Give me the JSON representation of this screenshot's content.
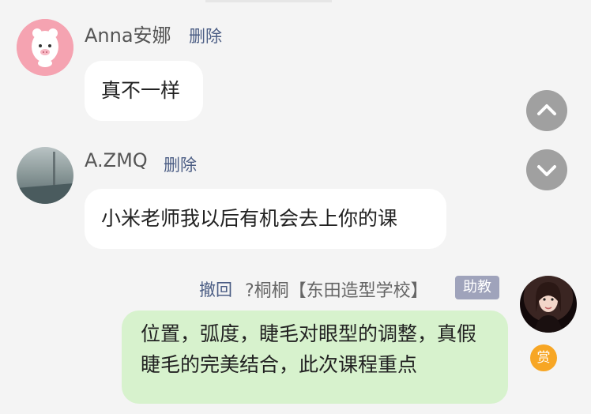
{
  "messages": [
    {
      "name": "Anna安娜",
      "action": "删除",
      "text": "真不一样"
    },
    {
      "name": "A.ZMQ",
      "action": "删除",
      "text": "小米老师我以后有机会去上你的课"
    },
    {
      "action": "撤回",
      "name": "?桐桐【东田造型学校】",
      "badge": "助教",
      "text": "位置，弧度，睫毛对眼型的调整，真假睫毛的完美结合，此次课程重点",
      "reward": "赏"
    }
  ],
  "icons": {
    "scroll_up": "chevron-up-icon",
    "scroll_down": "chevron-down-icon"
  }
}
